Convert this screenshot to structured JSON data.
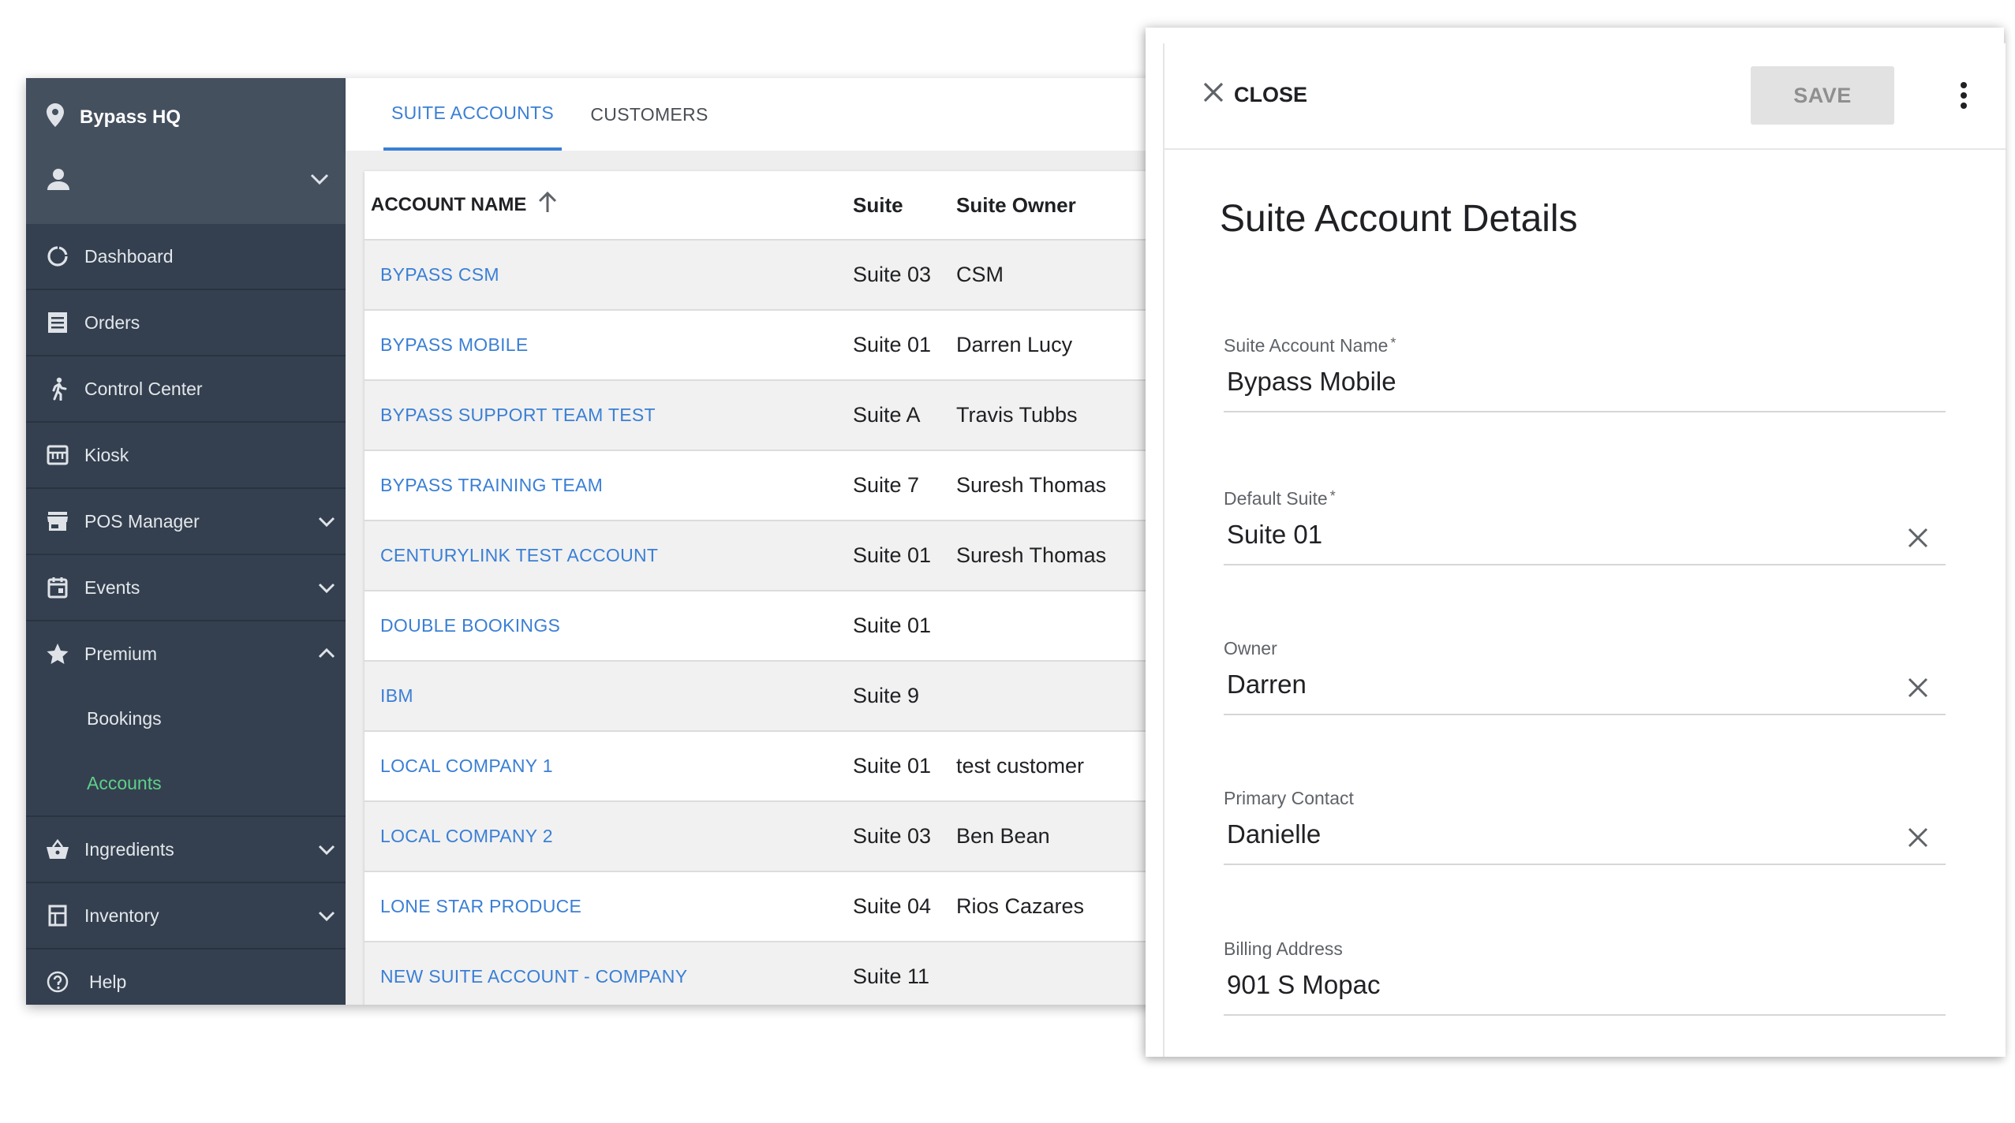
{
  "sidebar": {
    "venue": "Bypass HQ",
    "items": [
      {
        "label": "Dashboard",
        "icon": "dashboard-icon"
      },
      {
        "label": "Orders",
        "icon": "orders-icon"
      },
      {
        "label": "Control Center",
        "icon": "runner-icon"
      },
      {
        "label": "Kiosk",
        "icon": "kiosk-icon"
      },
      {
        "label": "POS Manager",
        "icon": "store-icon",
        "expandable": true
      },
      {
        "label": "Events",
        "icon": "calendar-icon",
        "expandable": true
      },
      {
        "label": "Premium",
        "icon": "star-icon",
        "expanded": true
      },
      {
        "label": "Ingredients",
        "icon": "basket-icon",
        "expandable": true
      },
      {
        "label": "Inventory",
        "icon": "inventory-icon",
        "expandable": true
      },
      {
        "label": "Help",
        "icon": "help-icon"
      }
    ],
    "premium_sub": [
      "Bookings",
      "Accounts"
    ],
    "active_sub": "Accounts",
    "active_color": "#5fd08b"
  },
  "tabs": [
    "SUITE ACCOUNTS",
    "CUSTOMERS"
  ],
  "table": {
    "headers": [
      "ACCOUNT NAME",
      "Suite",
      "Suite Owner"
    ],
    "rows": [
      {
        "name": "BYPASS CSM",
        "suite": "Suite 03",
        "owner": "CSM"
      },
      {
        "name": "BYPASS MOBILE",
        "suite": "Suite 01",
        "owner": "Darren Lucy"
      },
      {
        "name": "BYPASS SUPPORT TEAM TEST",
        "suite": "Suite A",
        "owner": "Travis Tubbs"
      },
      {
        "name": "BYPASS TRAINING TEAM",
        "suite": "Suite 7",
        "owner": "Suresh Thomas"
      },
      {
        "name": "CENTURYLINK TEST ACCOUNT",
        "suite": "Suite 01",
        "owner": "Suresh Thomas"
      },
      {
        "name": "DOUBLE BOOKINGS",
        "suite": "Suite 01",
        "owner": ""
      },
      {
        "name": "IBM",
        "suite": "Suite 9",
        "owner": ""
      },
      {
        "name": "LOCAL COMPANY 1",
        "suite": "Suite 01",
        "owner": "test customer"
      },
      {
        "name": "LOCAL COMPANY 2",
        "suite": "Suite 03",
        "owner": "Ben Bean"
      },
      {
        "name": "LONE STAR PRODUCE",
        "suite": "Suite 04",
        "owner": "Rios Cazares"
      },
      {
        "name": "NEW SUITE ACCOUNT - COMPANY",
        "suite": "Suite 11",
        "owner": ""
      }
    ]
  },
  "panel": {
    "close_label": "CLOSE",
    "save_label": "SAVE",
    "title": "Suite Account Details",
    "fields": [
      {
        "label": "Suite Account Name",
        "value": "Bypass Mobile",
        "required": "*"
      },
      {
        "label": "Default Suite",
        "value": "Suite 01",
        "required": "*"
      },
      {
        "label": "Owner",
        "value": "Darren"
      },
      {
        "label": "Primary Contact",
        "value": "Danielle"
      },
      {
        "label": "Billing Address",
        "value": "901 S Mopac"
      }
    ]
  },
  "colors": {
    "sidebar": "#34404f",
    "link": "#3a7fd5",
    "save_disabled_bg": "#e2e2e2"
  }
}
